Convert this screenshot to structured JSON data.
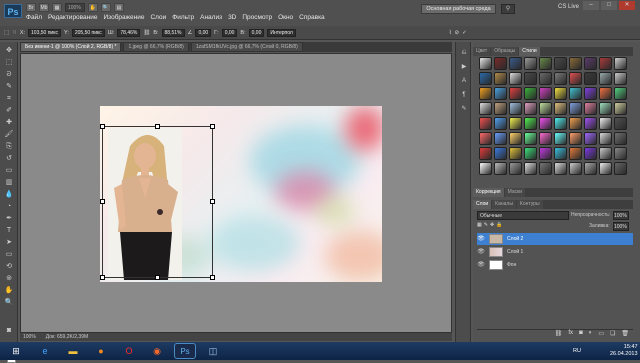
{
  "app": {
    "logo": "Ps"
  },
  "menu": [
    "Файл",
    "Редактирование",
    "Изображение",
    "Слои",
    "Фильтр",
    "Анализ",
    "3D",
    "Просмотр",
    "Окно",
    "Справка"
  ],
  "toolbar_top": {
    "zoom": "100%",
    "workspace": "Основная рабочая среда",
    "cs_live": "CS Live"
  },
  "options": {
    "x": "103,50 пикс",
    "y": "205,50 пикс",
    "w": "78,46%",
    "h": "88,51%",
    "angle": "0,00",
    "hskew": "0,00",
    "vskew": "0,00",
    "mode": "Интерпол"
  },
  "doc_tabs": [
    "Без имени-1 @ 100% (Слой 2, RGB/8) *",
    "1.jpeg @ 66,7% (RGB/8)",
    "1zafSM1fkUVc.jpg @ 66,7% (Слой 0, RGB/8)"
  ],
  "status": {
    "zoom": "100%",
    "doc": "Док: 659,2K/2,39M"
  },
  "style_panel_tabs": [
    "Цвет",
    "Образцы",
    "Стили"
  ],
  "adjust_tabs": [
    "Коррекция",
    "Маски"
  ],
  "layers_tabs": [
    "Слои",
    "Каналы",
    "Контуры"
  ],
  "layers": {
    "blend_mode": "Обычные",
    "opacity_label": "Непрозрачность:",
    "opacity": "100%",
    "fill_label": "Заливка:",
    "fill": "100%",
    "items": [
      {
        "name": "Слой 2",
        "selected": true
      },
      {
        "name": "Слой 1",
        "selected": false
      },
      {
        "name": "Фон",
        "selected": false
      }
    ]
  },
  "taskbar": {
    "lang": "RU",
    "time": "15:47",
    "date": "26.04.2013"
  },
  "icons": [
    "ps-logo-icon",
    "move-tool-icon",
    "marquee-tool-icon",
    "lasso-tool-icon",
    "crop-tool-icon",
    "brush-tool-icon",
    "eraser-tool-icon",
    "text-tool-icon",
    "hand-tool-icon",
    "zoom-tool-icon",
    "eye-icon",
    "windows-start-icon",
    "ie-icon",
    "explorer-icon",
    "firefox-icon",
    "opera-icon",
    "photoshop-icon"
  ]
}
